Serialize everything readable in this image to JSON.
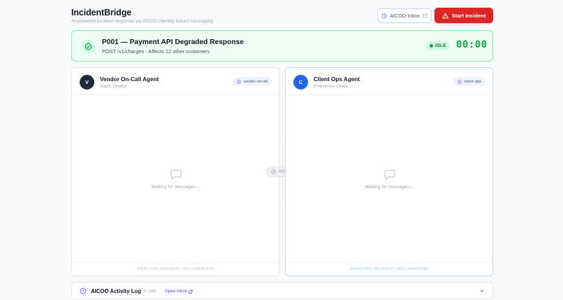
{
  "header": {
    "title": "IncidentBridge",
    "subtitle": "AI-powered incident response via AICOO identity-based messaging",
    "inbox_label": "AICOO Inbox",
    "start_label": "Start Incident"
  },
  "incident": {
    "title": "P001 — Payment API Degraded Response",
    "details": "POST /v1/charges · Affects 12 other customers",
    "status": "IDLE",
    "timer": "00:00"
  },
  "vendor": {
    "initial": "V",
    "name": "Vendor On-Call Agent",
    "org": "SaaS Vendor",
    "tag": "vendor-oncall",
    "empty": "Waiting for messages...",
    "footer": "AWAITING INCIDENT DECLARATION"
  },
  "client": {
    "initial": "C",
    "name": "Client Ops Agent",
    "org": "Enterprise Client",
    "tag": "client-ops",
    "empty": "Waiting for messages...",
    "footer": "AWAITING INCIDENT DECLARATION"
  },
  "bridge": {
    "label": "AICOO"
  },
  "activity": {
    "title": "AICOO Activity Log",
    "calls": "0 calls",
    "link": "Open Inbox"
  },
  "icons": {
    "inbox": "clock-icon",
    "start": "warning-triangle-icon",
    "banner": "check-circle-icon",
    "tag": "clock-icon",
    "empty": "chat-bubble-icon",
    "external": "external-link-icon",
    "chevron": "chevron-down-icon"
  },
  "colors": {
    "accent_red": "#dc2626",
    "accent_green": "#16a34a",
    "accent_blue": "#2563eb",
    "accent_indigo": "#4f46e5"
  }
}
